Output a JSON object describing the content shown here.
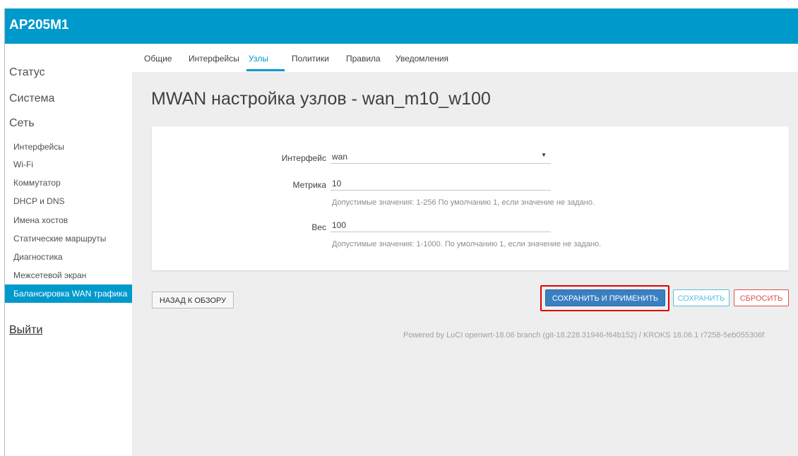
{
  "app": {
    "title": "AP205M1"
  },
  "sidebar": {
    "top_items": [
      {
        "label": "Статус"
      },
      {
        "label": "Система"
      },
      {
        "label": "Сеть"
      }
    ],
    "sub_items": [
      {
        "label": "Интерфейсы"
      },
      {
        "label": "Wi-Fi"
      },
      {
        "label": "Коммутатор"
      },
      {
        "label": "DHCP и DNS"
      },
      {
        "label": "Имена хостов"
      },
      {
        "label": "Статические маршруты"
      },
      {
        "label": "Диагностика"
      },
      {
        "label": "Межсетевой экран"
      },
      {
        "label": "Балансировка WAN трафика",
        "active": true
      }
    ],
    "logout_label": "Выйти"
  },
  "tabs": [
    {
      "label": "Общие"
    },
    {
      "label": "Интерфейсы"
    },
    {
      "label": "Узлы",
      "active": true
    },
    {
      "label": "Политики"
    },
    {
      "label": "Правила"
    },
    {
      "label": "Уведомления"
    }
  ],
  "page": {
    "title": "MWAN настройка узлов - wan_m10_w100"
  },
  "form": {
    "interface": {
      "label": "Интерфейс",
      "value": "wan"
    },
    "metric": {
      "label": "Метрика",
      "value": "10",
      "hint": "Допустимые значения: 1-256 По умолчанию 1, если значение не задано."
    },
    "weight": {
      "label": "Вес",
      "value": "100",
      "hint": "Допустимые значения: 1-1000. По умолчанию 1, если значение не задано."
    }
  },
  "buttons": {
    "back": "НАЗАД К ОБЗОРУ",
    "save_apply": "СОХРАНИТЬ И ПРИМЕНИТЬ",
    "save": "СОХРАНИТЬ",
    "reset": "СБРОСИТЬ"
  },
  "footer": {
    "text": "Powered by LuCI openwrt-18.06 branch (git-18.228.31946-f64b152) / KROKS 18.06.1 r7258-5eb055306f"
  },
  "colors": {
    "header": "#0099cc",
    "accent": "#0099cc",
    "primary_button": "#3a7fc0",
    "save_button": "#5bc0de",
    "reset_button": "#d9534f",
    "highlight": "#e00000"
  }
}
